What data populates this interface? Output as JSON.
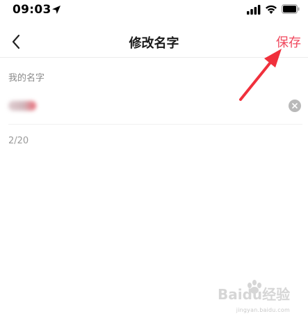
{
  "status_bar": {
    "time": "09:03",
    "location_icon": "location-arrow-icon",
    "signal_icon": "cellular-signal-icon",
    "wifi_icon": "wifi-icon",
    "battery_icon": "battery-icon"
  },
  "nav": {
    "back_icon": "chevron-left-icon",
    "title": "修改名字",
    "save_label": "保存"
  },
  "form": {
    "label": "我的名字",
    "name_value": "",
    "clear_icon": "clear-circle-icon",
    "char_count": "2/20"
  },
  "watermark": {
    "brand": "Baidu经验",
    "url": "jingyan.baidu.com"
  },
  "colors": {
    "accent": "#f0485d",
    "label": "#8a8a8a",
    "divider": "#ececec"
  }
}
